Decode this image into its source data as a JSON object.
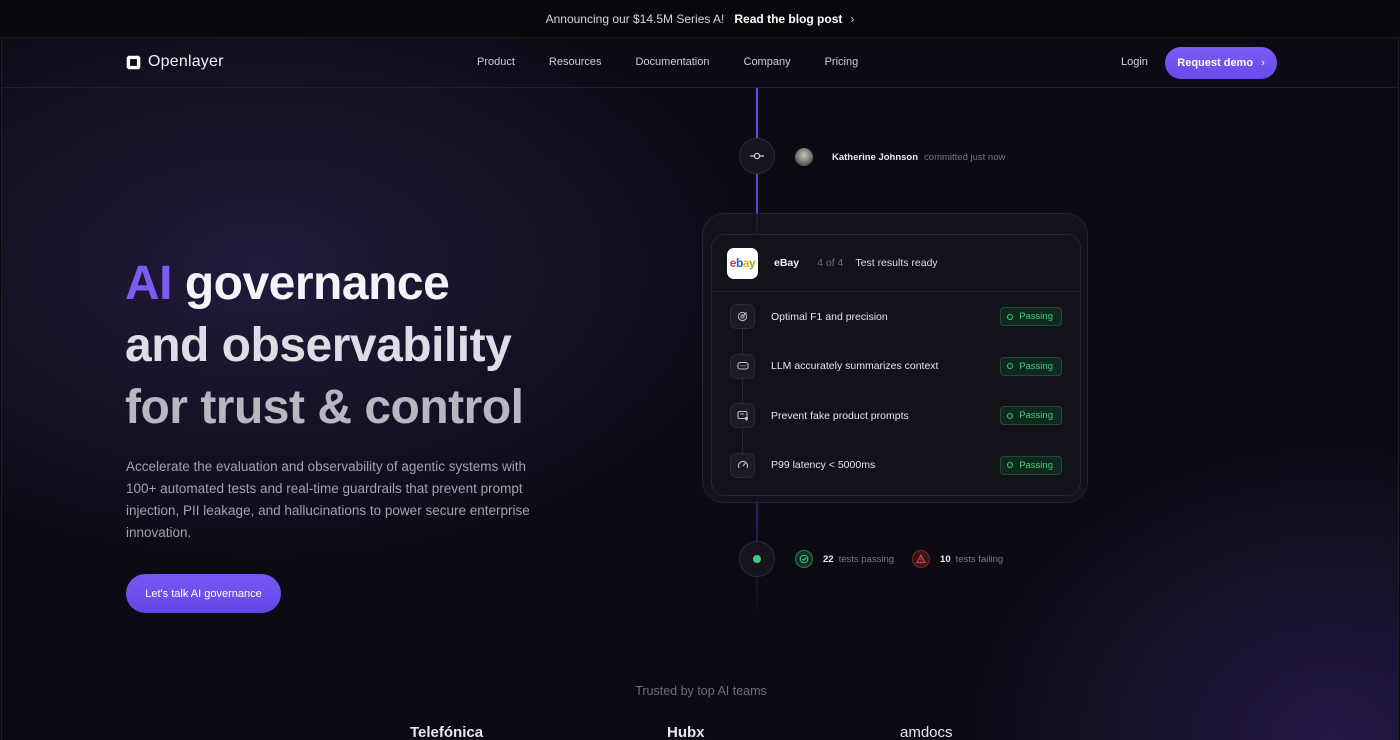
{
  "announcement": {
    "text": "Announcing our $14.5M Series A!",
    "link": "Read the blog post"
  },
  "nav": {
    "brand": "Openlayer",
    "items": [
      "Product",
      "Resources",
      "Documentation",
      "Company",
      "Pricing"
    ],
    "login": "Login",
    "demo": "Request demo"
  },
  "hero": {
    "title_ai": "AI",
    "title_l1": "governance",
    "title_l2": "and observability",
    "title_l3": "for trust & control",
    "subtitle": "Accelerate the evaluation and observability of agentic systems with 100+ automated tests and real-time guardrails that prevent prompt injection, PII leakage, and hallucinations to power secure enterprise innovation.",
    "cta": "Let's talk AI governance"
  },
  "commit": {
    "author": "Katherine Johnson",
    "action": "committed just now"
  },
  "card": {
    "org": "eBay",
    "count": "4 of 4",
    "status": "Test results ready",
    "tests": [
      {
        "label": "Optimal F1 and precision",
        "status": "Passing",
        "icon": "target-icon"
      },
      {
        "label": "LLM accurately summarizes context",
        "status": "Passing",
        "icon": "chat-icon"
      },
      {
        "label": "Prevent fake product prompts",
        "status": "Passing",
        "icon": "shield-screen-icon"
      },
      {
        "label": "P99 latency < 5000ms",
        "status": "Passing",
        "icon": "gauge-icon"
      }
    ]
  },
  "summary": {
    "passing_count": "22",
    "passing_label": "tests passing",
    "failing_count": "10",
    "failing_label": "tests failing"
  },
  "trusted": {
    "heading": "Trusted by top AI teams",
    "logos": [
      "Telefónica",
      "Hubx",
      "amdocs"
    ]
  },
  "colors": {
    "accent": "#7b5cf2",
    "pass": "#3fcb7c",
    "fail": "#e5484d"
  }
}
